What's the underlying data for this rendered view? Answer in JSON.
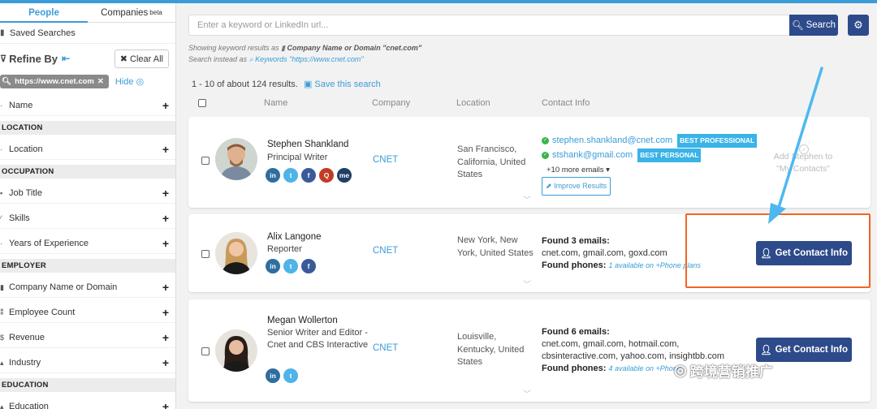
{
  "sidebar": {
    "tabs": [
      {
        "label": "People"
      },
      {
        "label": "Companies",
        "sup": "beta"
      }
    ],
    "saved_searches": "Saved Searches",
    "refine_by": "Refine By",
    "clear_all": "Clear All",
    "active_filter": "https://www.cnet.com",
    "hide": "Hide",
    "facets": {
      "name": "Name",
      "location_section": "LOCATION",
      "location": "Location",
      "occupation_section": "OCCUPATION",
      "job_title": "Job Title",
      "skills": "Skills",
      "years_experience": "Years of Experience",
      "employer_section": "EMPLOYER",
      "company_name": "Company Name or Domain",
      "employee_count": "Employee Count",
      "revenue": "Revenue",
      "industry": "Industry",
      "education_section": "EDUCATION",
      "education": "Education"
    }
  },
  "search": {
    "placeholder": "Enter a keyword or LinkedIn url...",
    "button": "Search",
    "showing_prefix": "Showing keyword results as",
    "showing_value": "Company Name or Domain \"cnet.com\"",
    "instead_prefix": "Search instead as",
    "instead_value": "Keywords \"https://www.cnet.com\""
  },
  "results": {
    "summary": "1 - 10 of about 124 results.",
    "save_search": "Save this search",
    "headers": {
      "name": "Name",
      "company": "Company",
      "location": "Location",
      "contact": "Contact Info"
    }
  },
  "people": [
    {
      "name": "Stephen Shankland",
      "title": "Principal Writer",
      "company": "CNET",
      "location": "San Francisco, California, United States",
      "email1": "stephen.shankland@cnet.com",
      "badge1": "BEST PROFESSIONAL",
      "email2": "stshank@gmail.com",
      "badge2": "BEST PERSONAL",
      "more_emails": "+10 more emails",
      "improve": "Improve Results",
      "add_label": "Add Stephen to \"My Contacts\""
    },
    {
      "name": "Alix Langone",
      "title": "Reporter",
      "company": "CNET",
      "location": "New York, New York, United States",
      "found_emails": "Found 3 emails:",
      "emails": "cnet.com, gmail.com, goxd.com",
      "found_phones": "Found phones:",
      "phones_note": "1 available on +Phone plans",
      "cta": "Get Contact Info"
    },
    {
      "name": "Megan Wollerton",
      "title": "Senior Writer and Editor - Cnet and CBS Interactive",
      "company": "CNET",
      "location": "Louisville, Kentucky, United States",
      "found_emails": "Found 6 emails:",
      "emails": "cnet.com, gmail.com, hotmail.com, cbsinteractive.com, yahoo.com, insightbb.com",
      "found_phones": "Found phones:",
      "phones_note": "4 available on +Phone",
      "cta": "Get Contact Info"
    }
  ],
  "watermark": "跨境营销推广",
  "colors": {
    "accent": "#3a9cd8",
    "primary_button": "#2d4a8a",
    "highlight": "#f26522",
    "arrow": "#4db8f0"
  }
}
